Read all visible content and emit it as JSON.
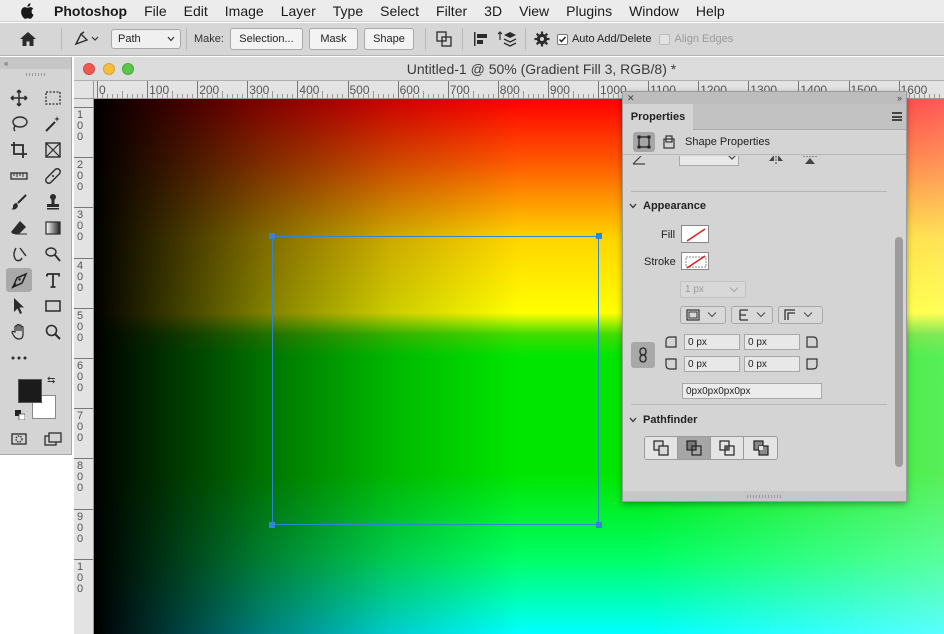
{
  "menubar": {
    "app_name": "Photoshop",
    "items": [
      "File",
      "Edit",
      "Image",
      "Layer",
      "Type",
      "Select",
      "Filter",
      "3D",
      "View",
      "Plugins",
      "Window",
      "Help"
    ]
  },
  "options_bar": {
    "mode_select": "Path",
    "make_label": "Make:",
    "selection_button": "Selection...",
    "mask_button": "Mask",
    "shape_button": "Shape",
    "auto_add_delete_label": "Auto Add/Delete",
    "auto_add_delete_checked": true,
    "align_edges_label": "Align Edges",
    "align_edges_checked": false
  },
  "document": {
    "title": "Untitled-1 @ 50% (Gradient Fill 3, RGB/8) *",
    "ruler_h_labels": [
      "0",
      "100",
      "200",
      "300",
      "400",
      "500",
      "600",
      "700",
      "800",
      "900",
      "1000",
      "1100",
      "1200",
      "1300",
      "1400",
      "1500",
      "1600"
    ],
    "ruler_v_labels": [
      "1\n0\n0",
      "2\n0\n0",
      "3\n0\n0",
      "4\n0\n0",
      "5\n0\n0",
      "6\n0\n0",
      "7\n0\n0",
      "8\n0\n0",
      "9\n0\n0",
      "1\n0\n0"
    ]
  },
  "properties": {
    "tab_label": "Properties",
    "subheader": "Shape Properties",
    "appearance_label": "Appearance",
    "fill_label": "Fill",
    "stroke_label": "Stroke",
    "stroke_width": "1 px",
    "corner_tl": "0 px",
    "corner_tr": "0 px",
    "corner_bl": "0 px",
    "corner_br": "0 px",
    "corners_combined": "0px0px0px0px",
    "pathfinder_label": "Pathfinder"
  },
  "colors": {
    "accent_selection": "#2f86d4",
    "foreground": "#1b1b1b",
    "background": "#ffffff"
  }
}
